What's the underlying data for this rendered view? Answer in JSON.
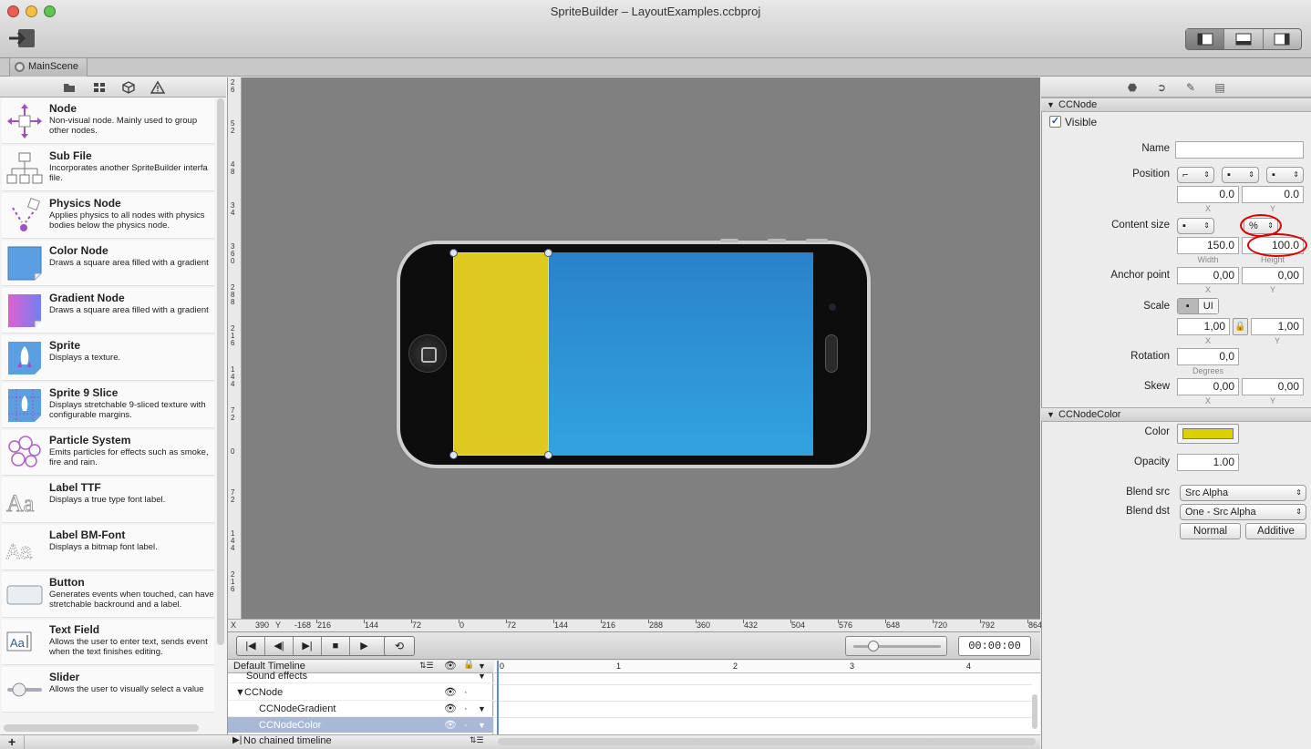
{
  "window": {
    "title": "SpriteBuilder – LayoutExamples.ccbproj"
  },
  "tab": {
    "label": "MainScene"
  },
  "library": {
    "items": [
      {
        "title": "Node",
        "desc": "Non-visual node. Mainly used to group other nodes."
      },
      {
        "title": "Sub File",
        "desc": "Incorporates another SpriteBuilder interfa file."
      },
      {
        "title": "Physics Node",
        "desc": "Applies physics to all nodes with physics bodies below the physics node."
      },
      {
        "title": "Color Node",
        "desc": "Draws a square area filled with a gradient"
      },
      {
        "title": "Gradient Node",
        "desc": "Draws a square area filled with a gradient"
      },
      {
        "title": "Sprite",
        "desc": "Displays a texture."
      },
      {
        "title": "Sprite 9 Slice",
        "desc": "Displays stretchable 9-sliced texture with configurable margins."
      },
      {
        "title": "Particle System",
        "desc": "Emits particles for effects such as smoke, fire and rain."
      },
      {
        "title": "Label TTF",
        "desc": "Displays a true type font label."
      },
      {
        "title": "Label BM-Font",
        "desc": "Displays a bitmap font label."
      },
      {
        "title": "Button",
        "desc": "Generates events when touched, can have stretchable backround and a label."
      },
      {
        "title": "Text Field",
        "desc": "Allows the user to enter text, sends event when the text finishes editing."
      },
      {
        "title": "Slider",
        "desc": "Allows the user to visually select a value"
      }
    ],
    "add_label": "+"
  },
  "canvas": {
    "ruler_x_label": "X",
    "ruler_x_value": "390",
    "ruler_y_label": "Y",
    "ruler_y_value": "-168",
    "h_ticks": [
      "216",
      "144",
      "72",
      "0",
      "72",
      "144",
      "216",
      "288",
      "360",
      "432",
      "504",
      "576",
      "648",
      "720",
      "792",
      "864"
    ],
    "v_ticks": [
      "2\n6",
      "5\n2",
      "4\n8",
      "3\n4",
      "3\n6\n0",
      "2\n8\n8",
      "2\n1\n6",
      "1\n4\n4",
      "7\n2",
      "0",
      "7\n2",
      "1\n4\n4",
      "2\n1\n6"
    ],
    "colors": {
      "yellow": "#ddc920",
      "blue": "#2a8fd3"
    }
  },
  "timeline": {
    "time": "00:00:00",
    "header_label": "Default Timeline",
    "scale_ticks": [
      "0",
      "1",
      "2",
      "3",
      "4"
    ],
    "rows": [
      {
        "label": "Sound effects"
      },
      {
        "label": "CCNode"
      },
      {
        "label": "CCNodeGradient"
      },
      {
        "label": "CCNodeColor"
      }
    ],
    "chained_label": "No chained timeline",
    "transport": [
      "|◀",
      "◀|",
      "▶|",
      "■",
      "▶"
    ]
  },
  "inspector": {
    "ccnode": {
      "header": "CCNode",
      "visible_label": "Visible",
      "name_label": "Name",
      "name_value": "",
      "position_label": "Position",
      "position_x": "0.0",
      "position_y": "0.0",
      "x_sub": "X",
      "y_sub": "Y",
      "content_size_label": "Content size",
      "content_unit": "%",
      "width_value": "150.0",
      "height_value": "100.0",
      "width_sub": "Width",
      "height_sub": "Height",
      "anchor_label": "Anchor point",
      "anchor_x": "0,00",
      "anchor_y": "0,00",
      "scale_label": "Scale",
      "scale_ui": "UI",
      "scale_x": "1,00",
      "scale_y": "1,00",
      "rotation_label": "Rotation",
      "rotation_value": "0,0",
      "degrees_sub": "Degrees",
      "skew_label": "Skew",
      "skew_x": "0,00",
      "skew_y": "0,00"
    },
    "ccnodecolor": {
      "header": "CCNodeColor",
      "color_label": "Color",
      "color_value": "#ddd000",
      "opacity_label": "Opacity",
      "opacity_value": "1.00",
      "blend_src_label": "Blend src",
      "blend_src_value": "Src Alpha",
      "blend_dst_label": "Blend dst",
      "blend_dst_value": "One - Src Alpha",
      "normal_button": "Normal",
      "additive_button": "Additive"
    }
  }
}
